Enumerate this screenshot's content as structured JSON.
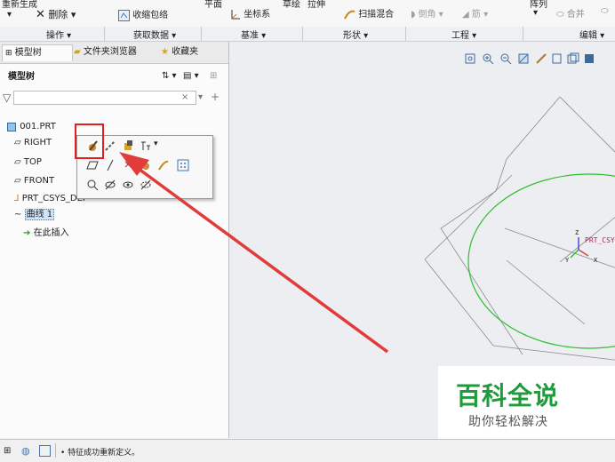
{
  "ribbon": {
    "regen_label": "重新生成",
    "delete_label": "删除",
    "shrinkwrap_label": "收缩包络",
    "plane_label": "平面",
    "csys_label": "坐标系",
    "sketch_label": "草绘",
    "extrude_label": "拉伸",
    "sweep_blend_label": "扫描混合",
    "round_label": "倒角",
    "rib_label": "筋",
    "pattern_label": "阵列",
    "merge_label": "合并",
    "groups": [
      "操作",
      "获取数据",
      "基准",
      "形状",
      "工程",
      "编辑"
    ]
  },
  "left_panel": {
    "tabs": [
      "模型树",
      "文件夹浏览器",
      "收藏夹"
    ],
    "header": "模型树",
    "filter_value": "",
    "clear_symbol": "×",
    "tree": [
      {
        "label": "001.PRT",
        "icon": "part-icon"
      },
      {
        "label": "RIGHT",
        "icon": "datum-plane-icon"
      },
      {
        "label": "TOP",
        "icon": "datum-plane-icon"
      },
      {
        "label": "FRONT",
        "icon": "datum-plane-icon"
      },
      {
        "label": "PRT_CSYS_DEF",
        "icon": "csys-icon"
      },
      {
        "label": "曲线 1",
        "icon": "curve-icon"
      },
      {
        "label": "在此插入",
        "icon": "insert-arrow-icon"
      }
    ]
  },
  "canvas": {
    "csys_label": "PRT_CSY",
    "axis_z": "Z",
    "axis_y": "Y",
    "axis_x": "X"
  },
  "watermark": {
    "title": "百科全说",
    "subtitle": "助你轻松解决"
  },
  "status": {
    "message": "• 特征成功重新定义。"
  },
  "colors": {
    "highlight_box": "#e02020",
    "arrow": "#e23b3b",
    "curve": "#2fbf2f",
    "datum_line": "#8c8c8c",
    "watermark_title": "#1e9b3a"
  }
}
